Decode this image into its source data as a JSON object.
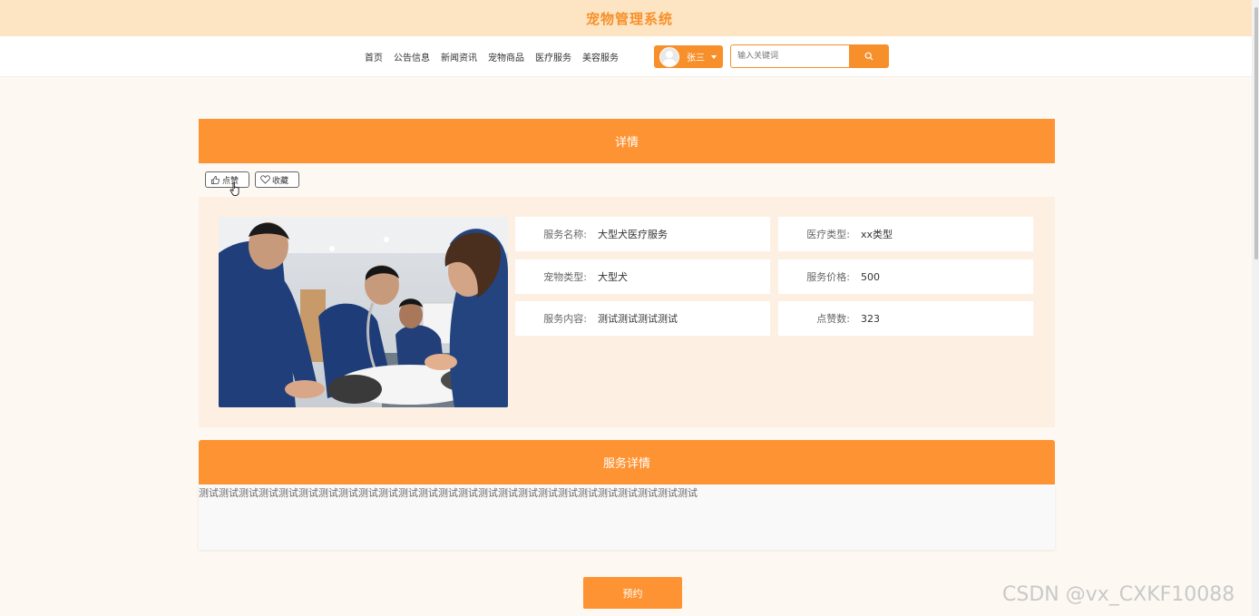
{
  "app": {
    "title": "宠物管理系统"
  },
  "nav": {
    "items": [
      {
        "label": "首页"
      },
      {
        "label": "公告信息"
      },
      {
        "label": "新闻资讯"
      },
      {
        "label": "宠物商品"
      },
      {
        "label": "医疗服务"
      },
      {
        "label": "美容服务"
      }
    ],
    "user": {
      "name": "张三"
    },
    "search": {
      "placeholder": "输入关键词"
    }
  },
  "detail": {
    "section_title": "详情",
    "like_label": "点赞",
    "favorite_label": "收藏",
    "fields": {
      "service_name": {
        "label": "服务名称:",
        "value": "大型犬医疗服务"
      },
      "medical_type": {
        "label": "医疗类型:",
        "value": "xx类型"
      },
      "pet_type": {
        "label": "宠物类型:",
        "value": "大型犬"
      },
      "price": {
        "label": "服务价格:",
        "value": "500"
      },
      "content": {
        "label": "服务内容:",
        "value": "测试测试测试测试"
      },
      "likes": {
        "label": "点赞数:",
        "value": "323"
      }
    }
  },
  "service_detail": {
    "section_title": "服务详情",
    "text": "测试测试测试测试测试测试测试测试测试测试测试测试测试测试测试测试测试测试测试测试测试测试测试测试测试"
  },
  "book_label": "预约",
  "watermark": "CSDN @vx_CXKF10088",
  "colors": {
    "accent": "#fe9333",
    "topbar": "#fde5c3",
    "title": "#f7902a"
  }
}
